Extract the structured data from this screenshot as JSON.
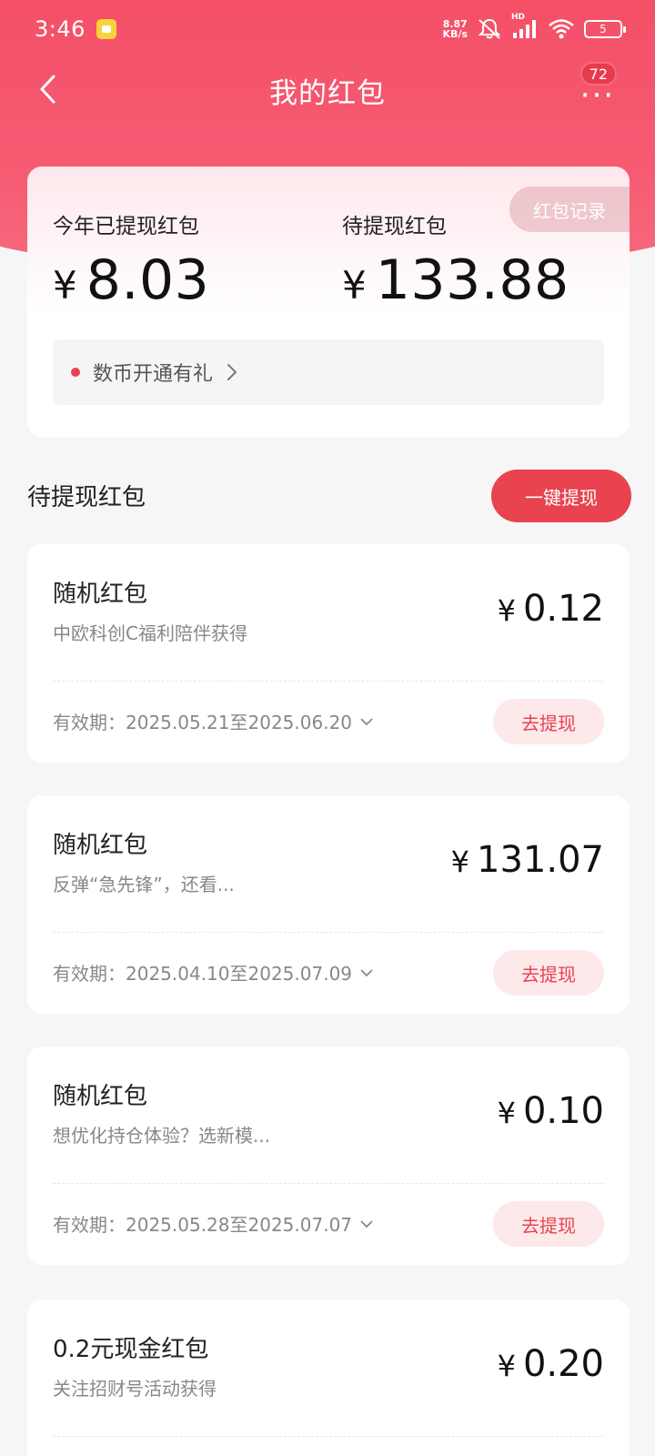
{
  "status_bar": {
    "time": "3:46",
    "net_speed_value": "8.87",
    "net_speed_unit": "KB/s",
    "hd_label": "HD",
    "battery": "5",
    "icons": [
      "app-notification-icon",
      "mute-icon",
      "signal-icon",
      "wifi-icon",
      "battery-icon"
    ]
  },
  "nav": {
    "title": "我的红包",
    "back_icon": "chevron-left-icon",
    "more_icon": "more-icon",
    "badge": "72"
  },
  "summary": {
    "withdrawn_label": "今年已提现红包",
    "withdrawn_currency": "¥",
    "withdrawn_amount": "8.03",
    "pending_label": "待提现红包",
    "pending_currency": "¥",
    "pending_amount": "133.88",
    "record_button": "红包记录",
    "promo_text": "数币开通有礼"
  },
  "section": {
    "title": "待提现红包",
    "withdraw_all_button": "一键提现"
  },
  "packets": [
    {
      "name": "随机红包",
      "desc": "中欧科创C福利陪伴获得",
      "currency": "¥",
      "amount": "0.12",
      "validity": "有效期：2025.05.21至2025.06.20",
      "button": "去提现"
    },
    {
      "name": "随机红包",
      "desc": "反弹“急先锋”，还看...",
      "currency": "¥",
      "amount": "131.07",
      "validity": "有效期：2025.04.10至2025.07.09",
      "button": "去提现"
    },
    {
      "name": "随机红包",
      "desc": "想优化持仓体验？选新模...",
      "currency": "¥",
      "amount": "0.10",
      "validity": "有效期：2025.05.28至2025.07.07",
      "button": "去提现"
    },
    {
      "name": "0.2元现金红包",
      "desc": "关注招财号活动获得",
      "currency": "¥",
      "amount": "0.20"
    }
  ],
  "colors": {
    "brand_red": "#e8434f",
    "header_gradient_top": "#f45068",
    "page_bg": "#f6f6f6"
  }
}
